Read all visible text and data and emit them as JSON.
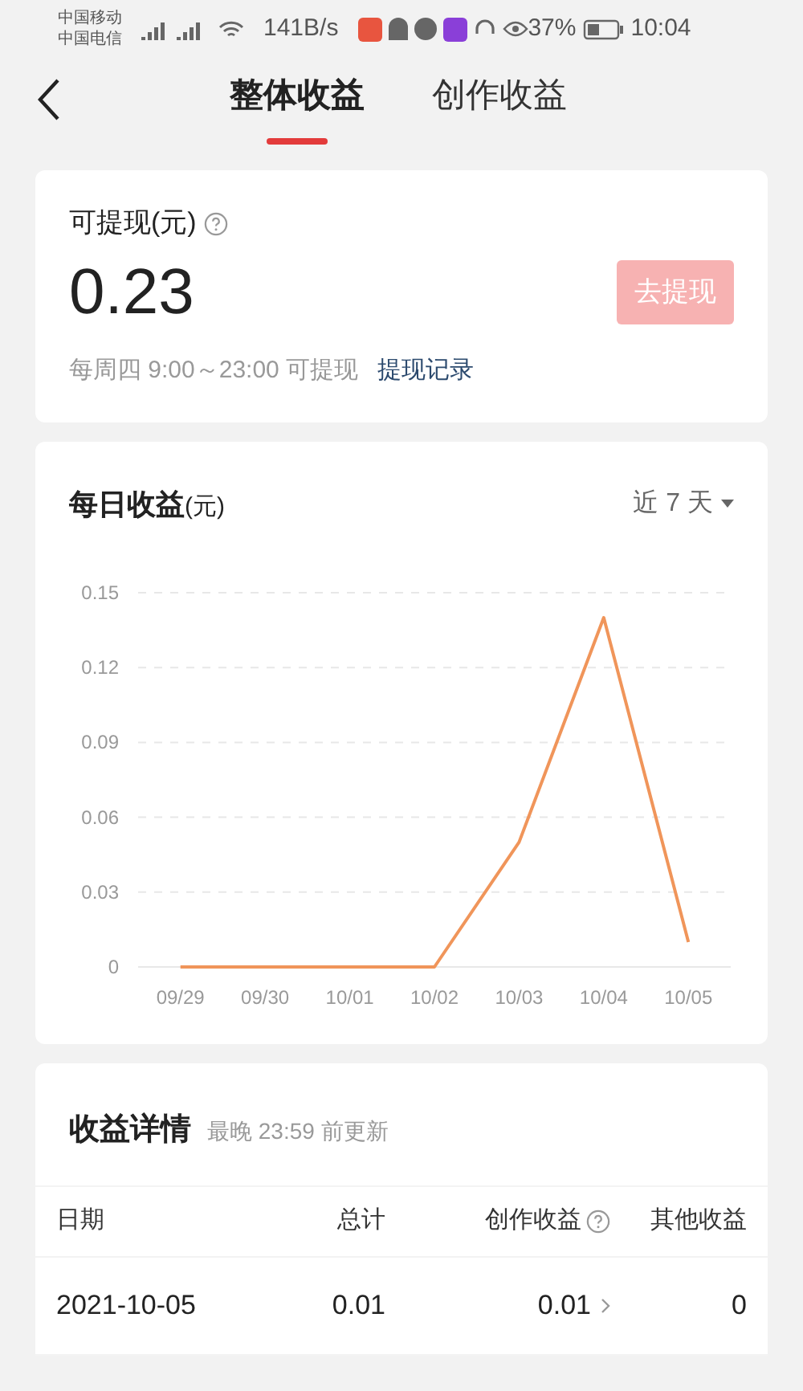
{
  "status_bar": {
    "carriers": [
      "中国移动",
      "中国电信"
    ],
    "network_speed": "141B/s",
    "battery": "37%",
    "time": "10:04"
  },
  "tabs": [
    {
      "label": "整体收益",
      "selected": true
    },
    {
      "label": "创作收益",
      "selected": false
    }
  ],
  "withdraw_card": {
    "label": "可提现(元)",
    "amount": "0.23",
    "button": {
      "label": "去提现",
      "disabled": true
    },
    "note": "每周四 9:00～23:00 可提现",
    "link": "提现记录"
  },
  "daily_card": {
    "title": "每日收益",
    "unit": "(元)",
    "range": "近 7 天",
    "chart_data": {
      "type": "line",
      "categories": [
        "09/29",
        "09/30",
        "10/01",
        "10/02",
        "10/03",
        "10/04",
        "10/05"
      ],
      "yticks": [
        0,
        0.03,
        0.06,
        0.09,
        0.12,
        0.15
      ],
      "ylim": [
        0,
        0.15
      ],
      "grid": true,
      "series": [
        {
          "color": "#f0955a",
          "values": [
            0,
            0,
            0,
            0,
            0.05,
            0.14,
            0.01
          ]
        }
      ]
    }
  },
  "details_card": {
    "title": "收益详情",
    "subtitle": "最晚 23:59 前更新",
    "columns": [
      {
        "label": "日期",
        "help": false
      },
      {
        "label": "总计",
        "help": false
      },
      {
        "label": "创作收益",
        "help": true
      },
      {
        "label": "其他收益",
        "help": false
      }
    ],
    "rows": [
      {
        "cells": [
          "2021-10-05",
          "0.01",
          "0.01",
          "0"
        ],
        "expandable": true
      }
    ]
  }
}
